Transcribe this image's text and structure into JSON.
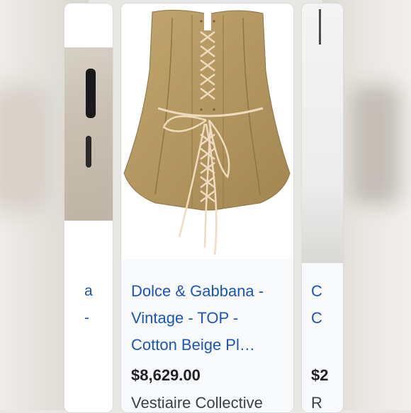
{
  "left_card": {
    "line1": "a",
    "line2": "-"
  },
  "main_card": {
    "title": "Dolce & Gabbana - Vintage - TOP - Cotton Beige Pl…",
    "price": "$8,629.00",
    "seller": "Vestiaire Collective",
    "image_alt": "beige lace-up corset top"
  },
  "right_card": {
    "line1": "C",
    "line2": "C",
    "price": "$2",
    "seller": "R"
  },
  "colors": {
    "link": "#1a55b8",
    "price": "#202124",
    "corset": "#b39660"
  }
}
